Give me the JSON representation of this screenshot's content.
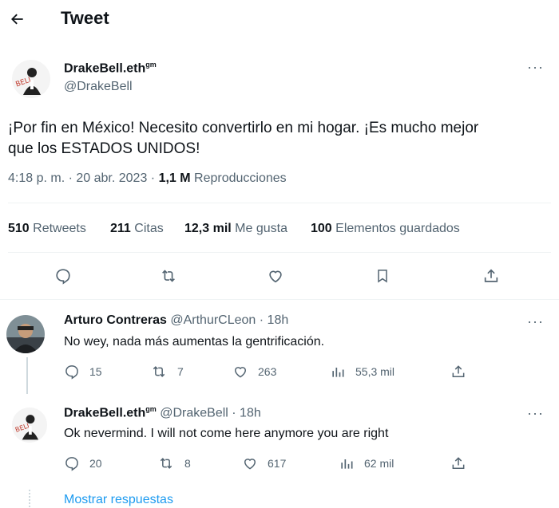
{
  "header": {
    "title": "Tweet"
  },
  "tweet": {
    "author_name": "DrakeBell.eth",
    "author_suffix": "gm",
    "author_handle": "@DrakeBell",
    "text_line1": "¡Por fin en México!  Necesito convertirlo en mi hogar.  ¡Es mucho mejor",
    "text_line2": "que los ESTADOS UNIDOS!",
    "time": "4:18 p. m. · 20 abr. 2023 · ",
    "views_count": "1,1 M",
    "views_label": " Reproducciones",
    "stats": {
      "retweets_count": "510",
      "retweets_label": " Retweets",
      "quotes_count": "211",
      "quotes_label": " Citas",
      "likes_count": "12,3 mil",
      "likes_label": " Me gusta",
      "bookmarks_count": "100",
      "bookmarks_label": " Elementos guardados"
    }
  },
  "replies": [
    {
      "name": "Arturo Contreras",
      "name_suffix": "",
      "handle": "@ArthurCLeon · 18h",
      "text": "No wey, nada más aumentas la gentrificación.",
      "replies": "15",
      "retweets": "7",
      "likes": "263",
      "views": "55,3 mil"
    },
    {
      "name": "DrakeBell.eth",
      "name_suffix": "gm",
      "handle": " @DrakeBell · 18h",
      "text": "Ok nevermind. I will not come here anymore you are right",
      "replies": "20",
      "retweets": "8",
      "likes": "617",
      "views": "62 mil"
    }
  ],
  "show_replies": "Mostrar respuestas",
  "colors": {
    "accent": "#1d9bf0",
    "muted": "#536471",
    "text": "#0f1419"
  }
}
